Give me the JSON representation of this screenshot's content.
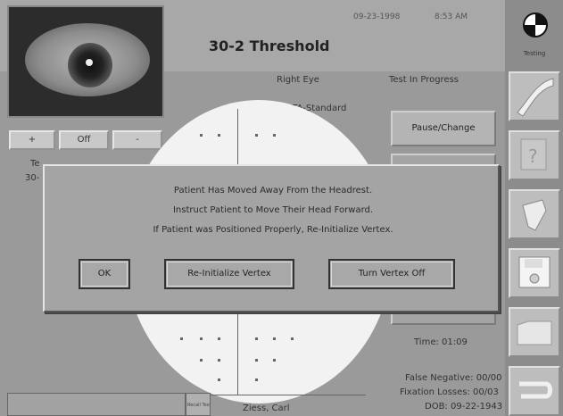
{
  "header": {
    "title": "30-2 Threshold",
    "date": "09-23-1998",
    "time": "8:53 AM"
  },
  "camera": {
    "minus_label": "+",
    "off_label": "Off",
    "plus_label": "-"
  },
  "test_info": {
    "eye": "Right Eye",
    "status": "Test In Progress",
    "strategy": "SITA-Standard",
    "test_label_partial": "Te",
    "id_partial": "30-",
    "elapsed_time": "Time: 01:09",
    "false_negative": "False Negative: 00/00",
    "fixation_losses": "Fixation Losses: 00/03",
    "dob": "DOB: 09-22-1943",
    "patient_name": "Ziess, Carl"
  },
  "side_buttons": {
    "pause_change": "Pause/Change"
  },
  "bottom": {
    "box_small_text": "Recall Test"
  },
  "toolbar": {
    "setting_label": "Testing",
    "icons": [
      "gear-icon",
      "ribbon-icon",
      "question-icon",
      "pen-icon",
      "disk-icon",
      "folder-icon",
      "cable-icon"
    ]
  },
  "dialog": {
    "line1": "Patient Has Moved Away From the Headrest.",
    "line2": "Instruct Patient to Move Their Head Forward.",
    "line3": "If Patient was Positioned Properly, Re-Initialize Vertex.",
    "ok_label": "OK",
    "reinit_label": "Re-Initialize Vertex",
    "vertex_off_label": "Turn Vertex Off"
  }
}
